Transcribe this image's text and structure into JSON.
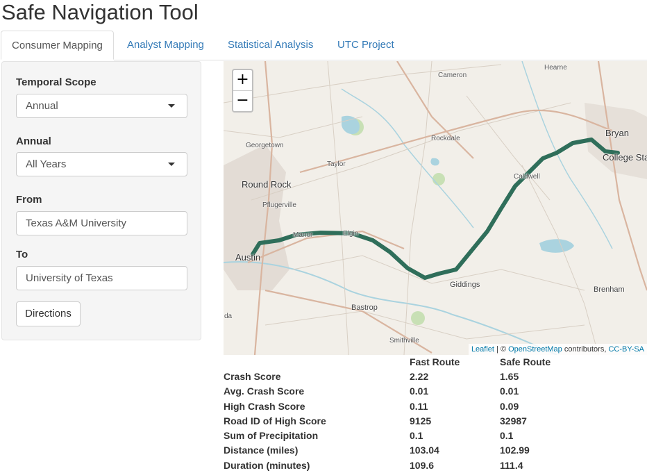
{
  "app": {
    "title": "Safe Navigation Tool"
  },
  "tabs": [
    {
      "label": "Consumer Mapping",
      "active": true
    },
    {
      "label": "Analyst Mapping"
    },
    {
      "label": "Statistical Analysis"
    },
    {
      "label": "UTC Project"
    }
  ],
  "sidebar": {
    "temporal_scope": {
      "label": "Temporal Scope",
      "value": "Annual"
    },
    "annual": {
      "label": "Annual",
      "value": "All Years"
    },
    "from": {
      "label": "From",
      "value": "Texas A&M University"
    },
    "to": {
      "label": "To",
      "value": "University of Texas"
    },
    "directions_button": "Directions"
  },
  "map": {
    "zoom_in": "+",
    "zoom_out": "−",
    "attribution": {
      "leaflet": "Leaflet",
      "separator": "| ©",
      "osm": "OpenStreetMap",
      "contributors": "contributors,",
      "license": "CC-BY-SA"
    },
    "places": {
      "cameron": "Cameron",
      "hearne": "Hearne",
      "bryan": "Bryan",
      "college_station": "College Sta",
      "rockdale": "Rockdale",
      "georgetown": "Georgetown",
      "taylor": "Taylor",
      "round_rock": "Round Rock",
      "caldwell": "Caldwell",
      "pflugerville": "Pflugerville",
      "manor": "Manor",
      "elgin": "Elgin",
      "austin": "Austin",
      "giddings": "Giddings",
      "brenham": "Brenham",
      "bastrop": "Bastrop",
      "da": "da",
      "smithville": "Smithville"
    },
    "route_color": "#2f6e5a",
    "water_color": "#aad3df",
    "park_color": "#c8e0b5"
  },
  "results": {
    "headers": [
      "",
      "Fast Route",
      "Safe Route"
    ],
    "rows": [
      [
        "Crash Score",
        "2.22",
        "1.65"
      ],
      [
        "Avg. Crash Score",
        "0.01",
        "0.01"
      ],
      [
        "High Crash Score",
        "0.11",
        "0.09"
      ],
      [
        "Road ID of High Score",
        "9125",
        "32987"
      ],
      [
        "Sum of Precipitation",
        "0.1",
        "0.1"
      ],
      [
        "Distance (miles)",
        "103.04",
        "102.99"
      ],
      [
        "Duration (minutes)",
        "109.6",
        "111.4"
      ]
    ]
  }
}
